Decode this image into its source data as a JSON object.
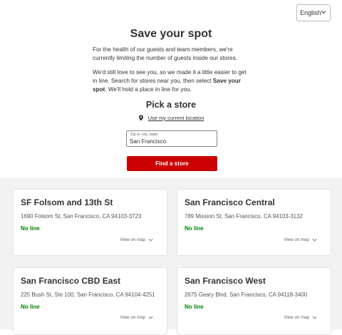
{
  "language": {
    "selected": "English"
  },
  "hero": {
    "title": "Save your spot",
    "paragraph1": "For the health of our guests and team members, we're currently limiting the number of guests inside our stores.",
    "paragraph2_prefix": "We'd still love to see you, so we made it a little easier to get in line. Search for stores near you, then select ",
    "paragraph2_bold": "Save your spot",
    "paragraph2_suffix": ". We'll hold a place in line for you."
  },
  "picker": {
    "heading": "Pick a store",
    "use_location": "Use my current location",
    "field_label": "Zip or city, state",
    "field_value": "San Francisco",
    "button": "Find a store"
  },
  "colors": {
    "primary": "#cc0000",
    "status_green": "#008300",
    "section_bg": "#f2f2f2"
  },
  "stores": [
    {
      "name": "SF Folsom and 13th St",
      "address": "1690 Folsom St, San Francisco, CA 94103-3723",
      "status": "No line",
      "map_link": "View on map"
    },
    {
      "name": "San Francisco Central",
      "address": "789 Mission St, San Francisco, CA 94103-3132",
      "status": "No line",
      "map_link": "View on map"
    },
    {
      "name": "San Francisco CBD East",
      "address": "225 Bush St, Ste 100, San Francisco, CA 94104-4251",
      "status": "No line",
      "map_link": "View on map"
    },
    {
      "name": "San Francisco West",
      "address": "2675 Geary Blvd, San Francisco, CA 94118-3400",
      "status": "No line",
      "map_link": "View on map"
    }
  ]
}
